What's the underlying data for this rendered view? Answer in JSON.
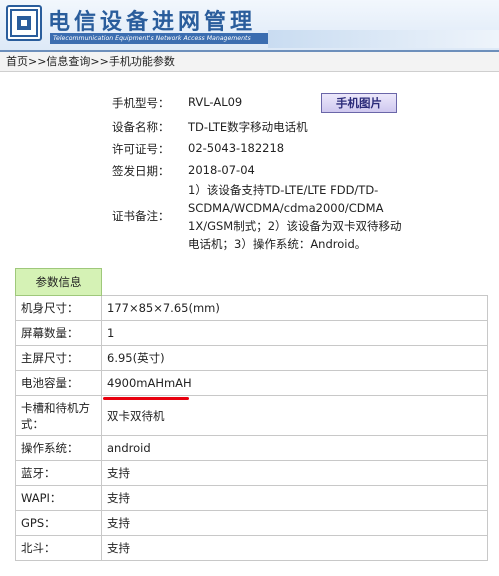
{
  "header": {
    "title": "电信设备进网管理",
    "subtitle": "Telecommunication Equipment's Network Access Managements"
  },
  "breadcrumb": "首页>>信息查询>>手机功能参数",
  "info": {
    "model_label": "手机型号：",
    "model_value": "RVL-AL09",
    "phone_image_button": "手机图片",
    "name_label": "设备名称：",
    "name_value": "TD-LTE数字移动电话机",
    "license_label": "许可证号：",
    "license_value": "02-5043-182218",
    "date_label": "签发日期：",
    "date_value": "2018-07-04",
    "remarks_label": "证书备注：",
    "remarks_value": "1）该设备支持TD-LTE/LTE FDD/TD-SCDMA/WCDMA/cdma2000/CDMA 1X/GSM制式；2）该设备为双卡双待移动电话机；3）操作系统：Android。"
  },
  "params": {
    "header": "参数信息",
    "rows": [
      {
        "key": "机身尺寸：",
        "value": "177×85×7.65(mm)"
      },
      {
        "key": "屏幕数量：",
        "value": "1"
      },
      {
        "key": "主屏尺寸：",
        "value": "6.95(英寸)"
      },
      {
        "key": "电池容量：",
        "value": "4900mAHmAH"
      },
      {
        "key": "卡槽和待机方式：",
        "value": "双卡双待机"
      },
      {
        "key": "操作系统：",
        "value": "android"
      },
      {
        "key": "蓝牙：",
        "value": "支持"
      },
      {
        "key": "WAPI：",
        "value": "支持"
      },
      {
        "key": "GPS：",
        "value": "支持"
      },
      {
        "key": "北斗：",
        "value": "支持"
      }
    ]
  },
  "colors": {
    "brand_blue": "#2a5d9c",
    "param_header_green": "#d5f2b5",
    "highlight_red": "#e8000e"
  }
}
